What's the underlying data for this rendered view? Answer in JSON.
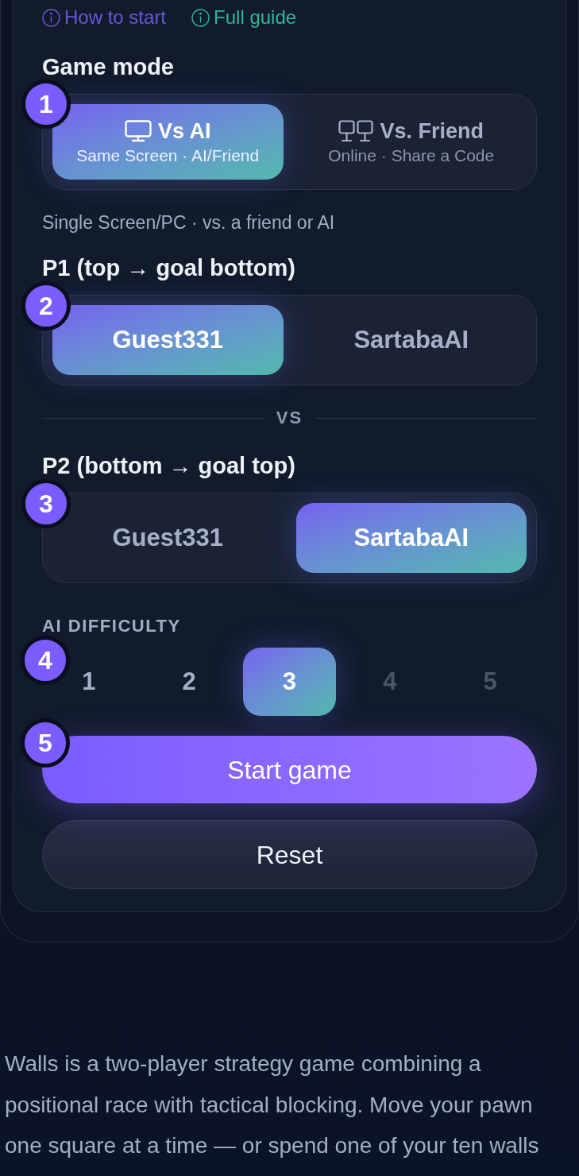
{
  "links": [
    {
      "label": "How to start",
      "color": "#6a56dc"
    },
    {
      "label": "Full guide",
      "color": "#2bb996"
    }
  ],
  "game_mode": {
    "heading": "Game mode",
    "step": "1",
    "options": [
      {
        "kind": "single",
        "title": "Vs AI",
        "subtitle": "Same Screen · AI/Friend",
        "selected": true
      },
      {
        "kind": "online",
        "title": "Vs. Friend",
        "subtitle": "Online · Share a Code",
        "selected": false
      }
    ],
    "note": "Single Screen/PC · vs. a friend or AI"
  },
  "player_1": {
    "heading": "P1 (top → goal bottom)",
    "step": "2",
    "options": [
      {
        "label": "Guest331",
        "selected": true
      },
      {
        "label": "SartabaAI",
        "selected": false
      }
    ]
  },
  "vs_divider": "VS",
  "player_2": {
    "heading": "P2 (bottom → goal top)",
    "step": "3",
    "options": [
      {
        "label": "Guest331",
        "selected": false
      },
      {
        "label": "SartabaAI",
        "selected": true
      }
    ]
  },
  "difficulty": {
    "heading": "AI DIFFICULTY",
    "step": "4",
    "levels": [
      {
        "label": "1",
        "selected": false,
        "disabled": false
      },
      {
        "label": "2",
        "selected": false,
        "disabled": false
      },
      {
        "label": "3",
        "selected": true,
        "disabled": false
      },
      {
        "label": "4",
        "selected": false,
        "disabled": true
      },
      {
        "label": "5",
        "selected": false,
        "disabled": true
      }
    ]
  },
  "start_button": {
    "label": "Start game",
    "step": "5"
  },
  "reset_button": {
    "label": "Reset"
  },
  "description": "Walls is a two-player strategy game combining a positional race with tactical blocking. Move your pawn one square at a time — or spend one of your ten walls"
}
